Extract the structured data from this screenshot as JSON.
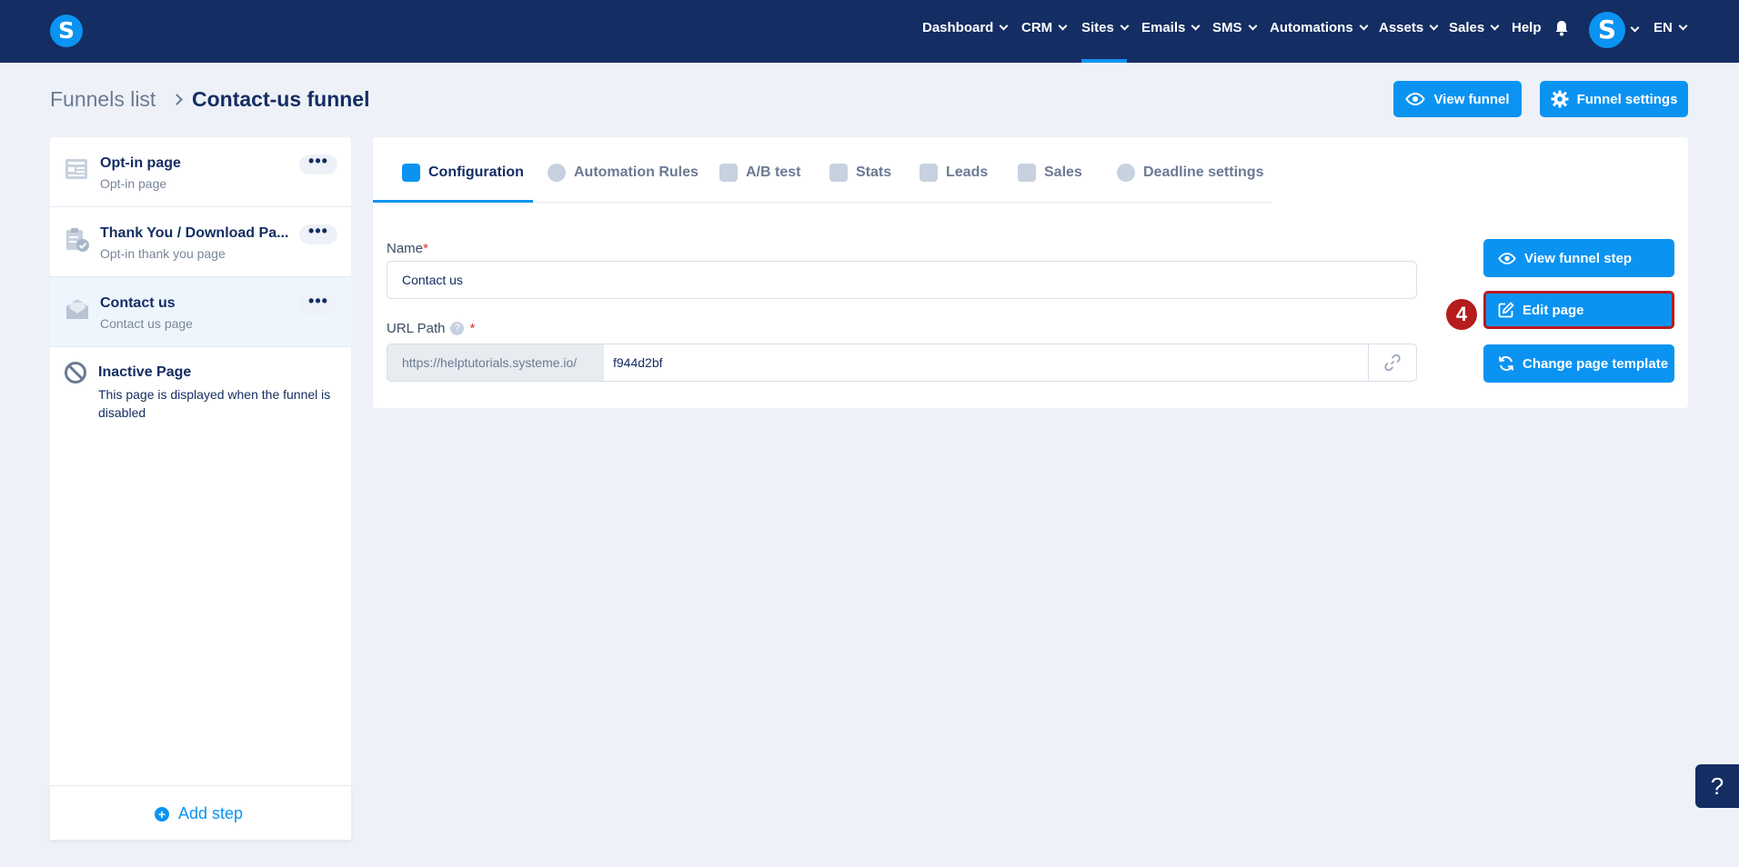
{
  "nav": {
    "logo": "S",
    "items": [
      {
        "label": "Dashboard",
        "has_chevron": true
      },
      {
        "label": "CRM",
        "has_chevron": true
      },
      {
        "label": "Sites",
        "has_chevron": true
      },
      {
        "label": "Emails",
        "has_chevron": true
      },
      {
        "label": "SMS",
        "has_chevron": true
      },
      {
        "label": "Automations",
        "has_chevron": true
      },
      {
        "label": "Assets",
        "has_chevron": true
      },
      {
        "label": "Sales",
        "has_chevron": true
      },
      {
        "label": "Help",
        "has_chevron": false
      }
    ],
    "active_item": "Sites",
    "avatar_letter": "S",
    "language": "EN"
  },
  "breadcrumb": {
    "parent": "Funnels list",
    "current": "Contact-us funnel"
  },
  "header_actions": {
    "view_funnel": "View funnel",
    "funnel_settings": "Funnel settings"
  },
  "steps": [
    {
      "title": "Opt-in page",
      "subtitle": "Opt-in page",
      "icon": "page-layout-icon",
      "active": false
    },
    {
      "title": "Thank You / Download Pa...",
      "subtitle": "Opt-in thank you page",
      "icon": "clipboard-check-icon",
      "active": false
    },
    {
      "title": "Contact us",
      "subtitle": "Contact us page",
      "icon": "envelope-open-icon",
      "active": true
    }
  ],
  "inactive_page": {
    "title": "Inactive Page",
    "description": "This page is displayed when the funnel is disabled"
  },
  "add_step": "Add step",
  "tabs": [
    {
      "label": "Configuration",
      "icon": "sliders-icon",
      "active": true
    },
    {
      "label": "Automation Rules",
      "icon": "lightning-icon",
      "active": false
    },
    {
      "label": "A/B test",
      "icon": "split-icon",
      "active": false
    },
    {
      "label": "Stats",
      "icon": "bar-chart-icon",
      "active": false
    },
    {
      "label": "Leads",
      "icon": "users-icon",
      "active": false
    },
    {
      "label": "Sales",
      "icon": "dollar-icon",
      "active": false
    },
    {
      "label": "Deadline settings",
      "icon": "clock-icon",
      "active": false
    }
  ],
  "form": {
    "name_label": "Name",
    "name_value": "Contact us",
    "url_label": "URL Path",
    "url_prefix": "https://helptutorials.systeme.io/",
    "url_value": "f944d2bf",
    "required_mark": "*"
  },
  "actions": {
    "view_step": "View funnel step",
    "edit_page": "Edit page",
    "change_template": "Change page template"
  },
  "annotation_badge": "4",
  "help_fab": "?",
  "colors": {
    "nav_bg": "#142d63",
    "accent": "#0b93f2",
    "badge": "#b51c1c",
    "page_bg": "#eef2f8"
  }
}
